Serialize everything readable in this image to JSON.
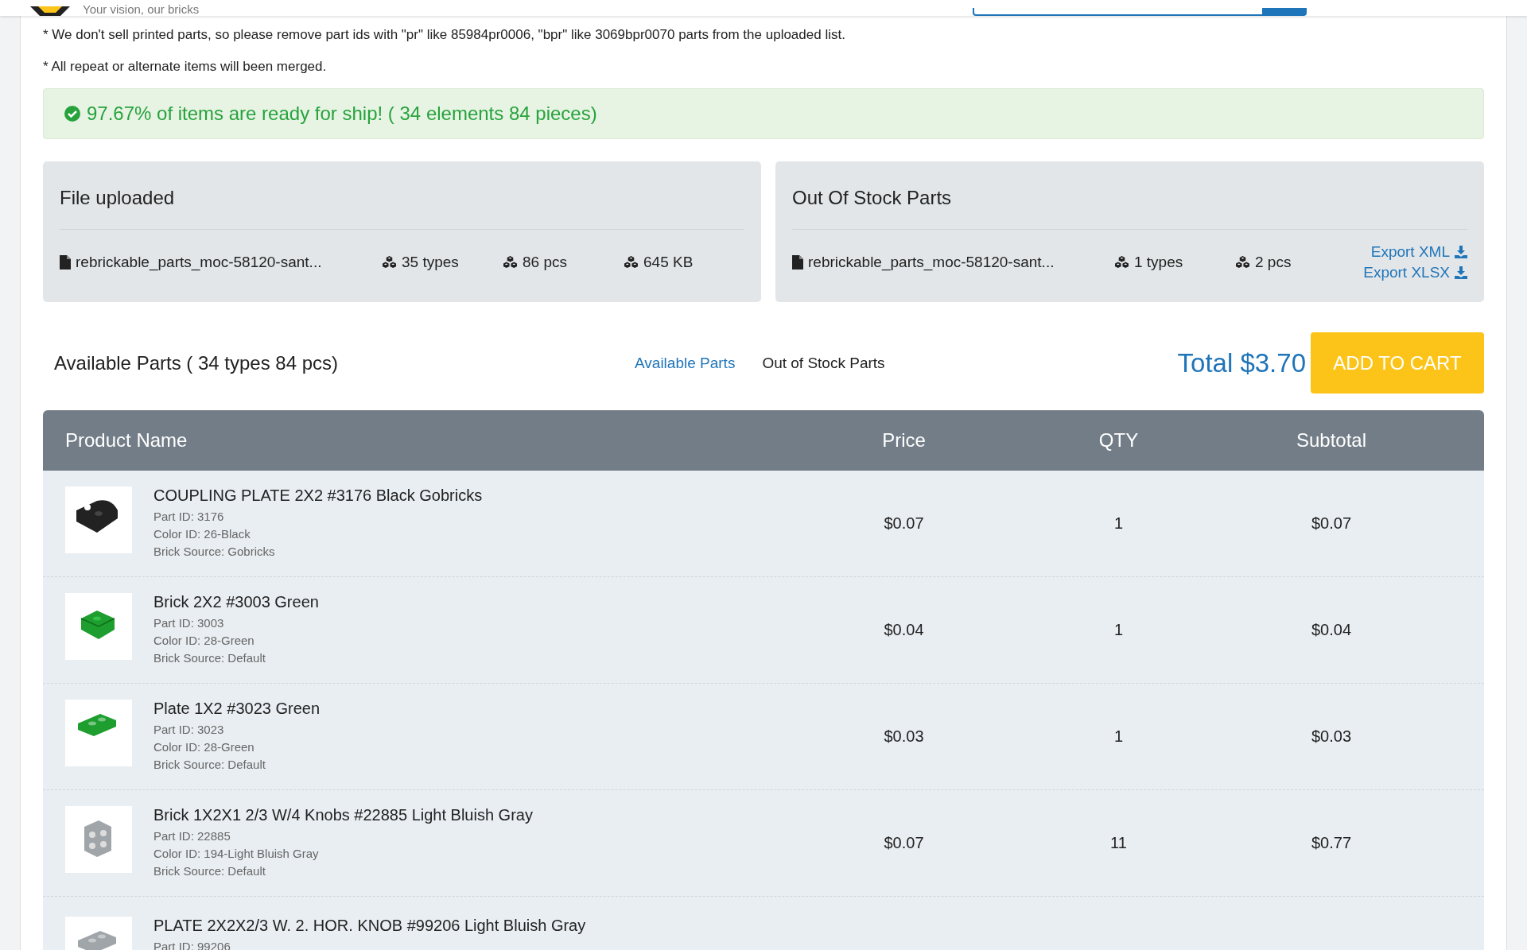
{
  "header": {
    "tagline": "Your vision, our bricks"
  },
  "notes": [
    "* We don't sell printed parts, so please remove part ids with \"pr\" like 85984pr0006, \"bpr\" like 3069bpr0070 parts from the uploaded list.",
    "* All repeat or alternate items will been merged."
  ],
  "alert": {
    "text": "97.67% of items are ready for ship! ( 34 elements 84 pieces)"
  },
  "cards": [
    {
      "title": "File uploaded",
      "file": "rebrickable_parts_moc-58120-sant...",
      "stats": [
        "35 types",
        "86 pcs",
        "645 KB"
      ]
    },
    {
      "title": "Out Of Stock Parts",
      "file": "rebrickable_parts_moc-58120-sant...",
      "stats": [
        "1 types",
        "2 pcs"
      ],
      "exports": [
        "Export XML",
        "Export XLSX"
      ]
    }
  ],
  "section": {
    "title": "Available Parts ( 34 types 84 pcs)",
    "tabs": [
      {
        "label": "Available Parts",
        "selected": true
      },
      {
        "label": "Out of Stock Parts",
        "selected": false
      }
    ],
    "total": "Total $3.70",
    "button": "ADD TO CART"
  },
  "table": {
    "columns": [
      "Product Name",
      "Price",
      "QTY",
      "Subtotal"
    ],
    "rows": [
      {
        "name": "COUPLING PLATE 2X2 #3176 Black Gobricks",
        "details": [
          "Part ID: 3176",
          "Color ID: 26-Black",
          "Brick Source: Gobricks"
        ],
        "price": "$0.07",
        "qty": "1",
        "subtotal": "$0.07",
        "color": "#222222",
        "kind": "coupling"
      },
      {
        "name": "Brick 2X2 #3003 Green",
        "details": [
          "Part ID: 3003",
          "Color ID: 28-Green",
          "Brick Source: Default"
        ],
        "price": "$0.04",
        "qty": "1",
        "subtotal": "$0.04",
        "color": "#1e9e2e",
        "kind": "brick"
      },
      {
        "name": "Plate 1X2 #3023 Green",
        "details": [
          "Part ID: 3023",
          "Color ID: 28-Green",
          "Brick Source: Default"
        ],
        "price": "$0.03",
        "qty": "1",
        "subtotal": "$0.03",
        "color": "#1e9e2e",
        "kind": "plate"
      },
      {
        "name": "Brick 1X2X1 2/3 W/4 Knobs #22885 Light Bluish Gray",
        "details": [
          "Part ID: 22885",
          "Color ID: 194-Light Bluish Gray",
          "Brick Source: Default"
        ],
        "price": "$0.07",
        "qty": "11",
        "subtotal": "$0.77",
        "color": "#a0a5a9",
        "kind": "side"
      },
      {
        "name": "PLATE 2X2X2/3 W. 2. HOR. KNOB #99206 Light Bluish Gray",
        "details": [
          "Part ID: 99206"
        ],
        "color": "#a0a5a9",
        "kind": "plate"
      }
    ]
  }
}
